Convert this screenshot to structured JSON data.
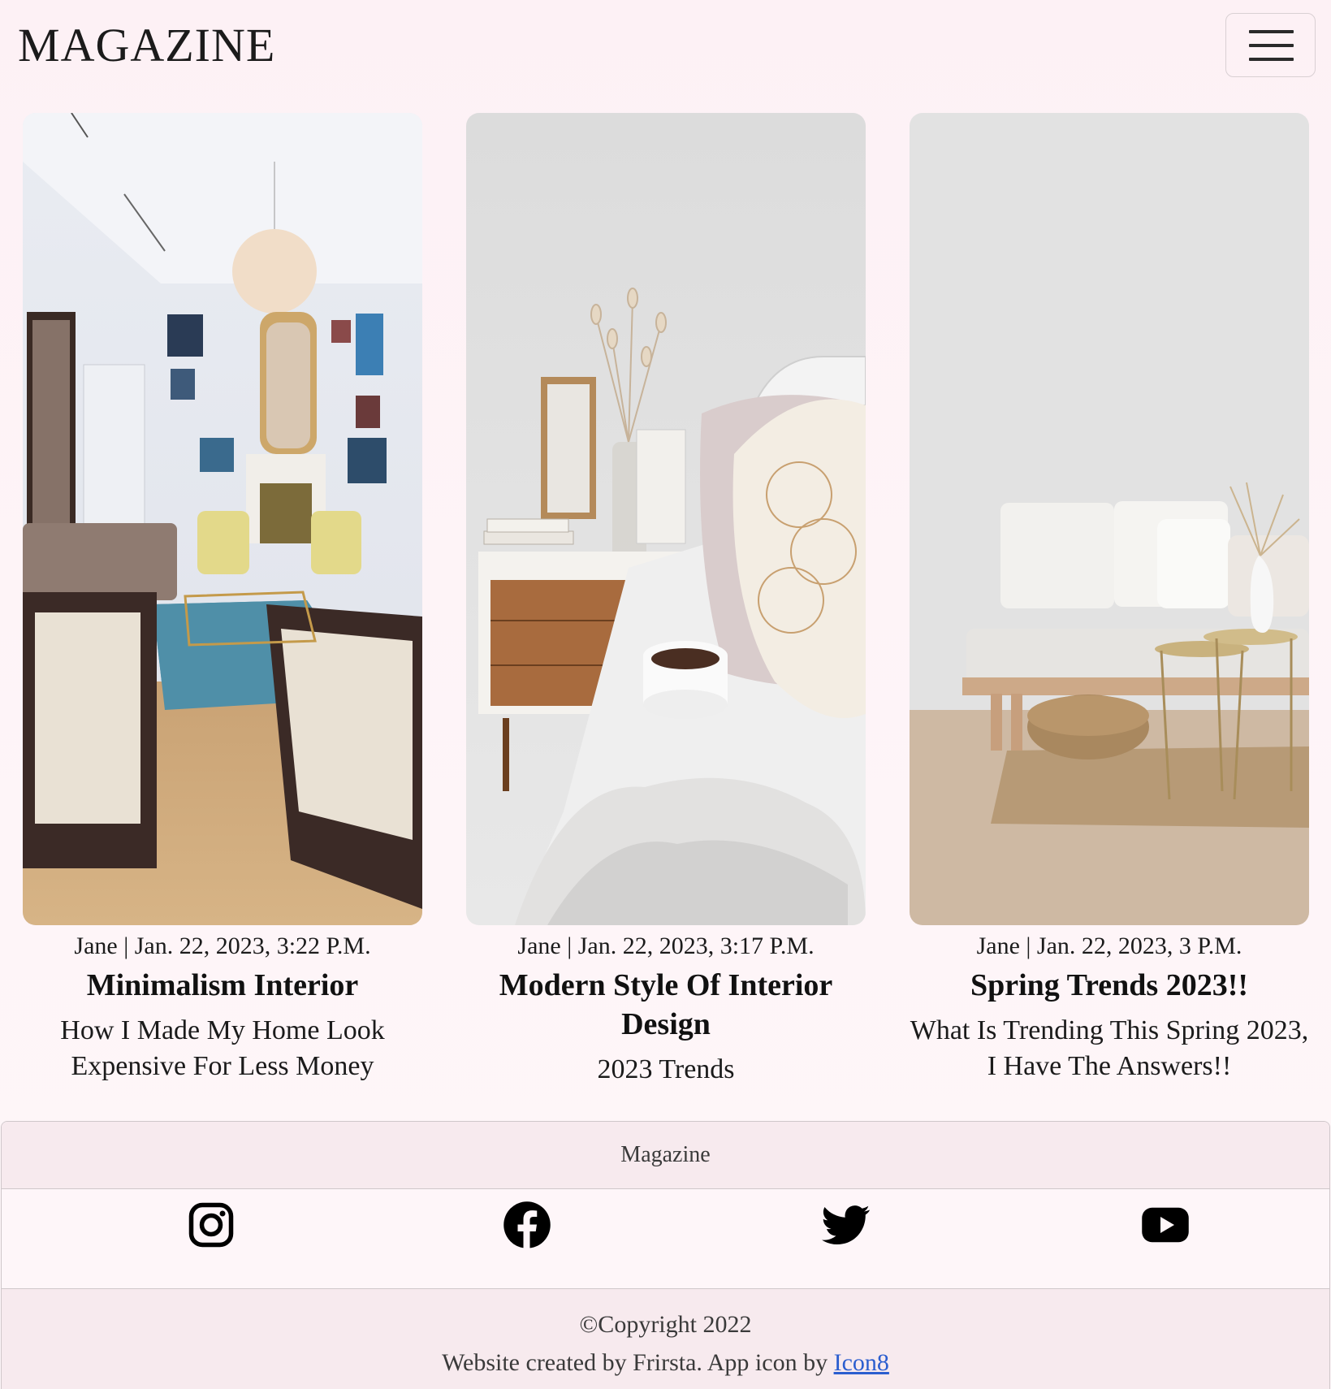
{
  "header": {
    "brand": "MAGAZINE",
    "menu_icon": "hamburger-menu-icon"
  },
  "posts": [
    {
      "meta": "Jane | Jan. 22, 2023, 3:22 P.M.",
      "title": "Minimalism Interior",
      "subtitle": "How I Made My Home Look Expensive For Less Money",
      "image": "living-room-photo"
    },
    {
      "meta": "Jane | Jan. 22, 2023, 3:17 P.M.",
      "title": "Modern Style Of Interior Design",
      "subtitle": "2023 Trends",
      "image": "bedroom-nightstand-photo"
    },
    {
      "meta": "Jane | Jan. 22, 2023, 3 P.M.",
      "title": "Spring Trends 2023!!",
      "subtitle": "What Is Trending This Spring 2023, I Have The Answers!!",
      "image": "sofa-living-room-photo"
    }
  ],
  "footer": {
    "title": "Magazine",
    "social": [
      "instagram-icon",
      "facebook-icon",
      "twitter-icon",
      "youtube-icon"
    ],
    "copyright": "©Copyright 2022",
    "credit_text": "Website created by Frirsta. App icon by ",
    "credit_link": "Icon8",
    "link_color": "#2b5ecf"
  }
}
